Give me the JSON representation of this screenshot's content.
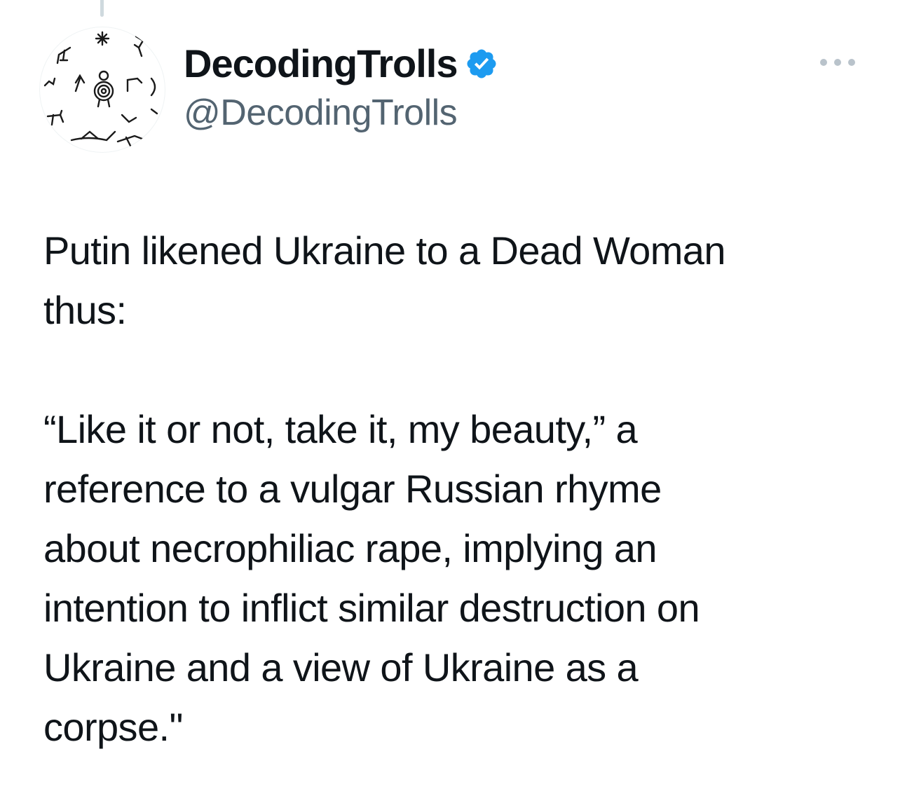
{
  "account": {
    "display_name": "DecodingTrolls",
    "handle": "@DecodingTrolls",
    "verified": true,
    "verified_icon": "verified-badge-icon",
    "verified_color": "#1d9bf0",
    "avatar_icon": "petroglyph-avatar"
  },
  "more_icon": "more-horizontal-icon",
  "tweet": {
    "text": "Putin likened Ukraine to a Dead Woman\nthus:\n\n“Like it or not, take it, my beauty,” a\nreference to a vulgar Russian rhyme\nabout necrophiliac rape, implying an\nintention to inflict similar destruction on\nUkraine and a view of Ukraine as a\ncorpse.\""
  },
  "colors": {
    "text_primary": "#0f1419",
    "text_secondary": "#536471",
    "thread_line": "#cfd9de",
    "background": "#ffffff"
  }
}
